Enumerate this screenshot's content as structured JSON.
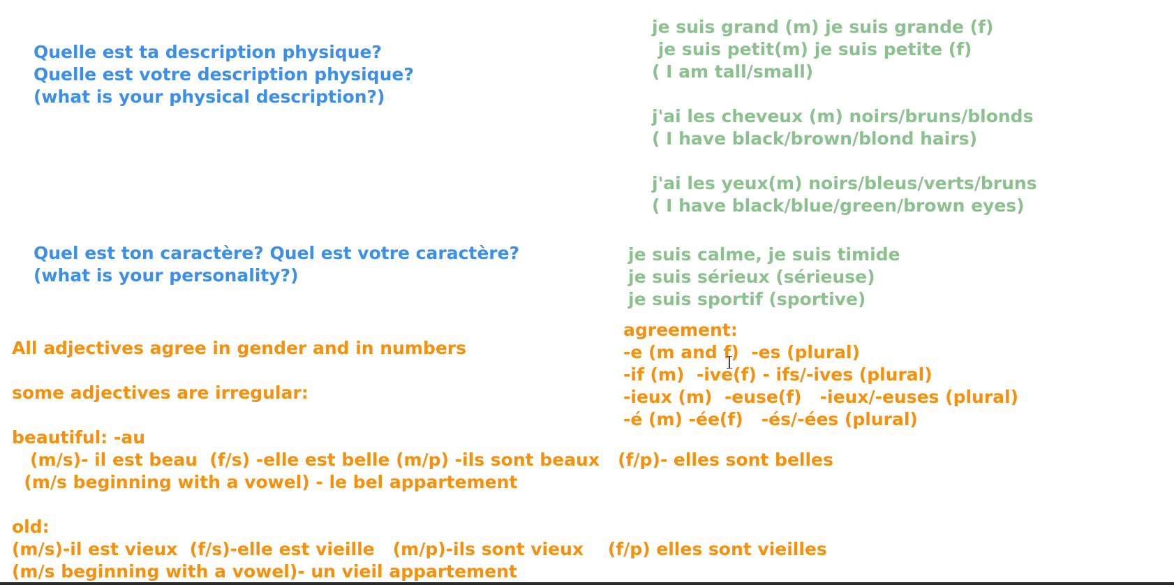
{
  "questions": {
    "physical": [
      "Quelle est ta description physique?",
      "Quelle est votre description physique?",
      "(what is your physical description?)"
    ],
    "personality": [
      "Quel est ton caractère? Quel est votre caractère?",
      "(what is your personality?)"
    ]
  },
  "answers": {
    "height": [
      "je suis grand (m) je suis grande (f)",
      " je suis petit(m) je suis petite (f)",
      "( I am tall/small)"
    ],
    "hair": [
      "j'ai les cheveux (m) noirs/bruns/blonds",
      "( I have black/brown/blond hairs)"
    ],
    "eyes": [
      "j'ai les yeux(m) noirs/bleus/verts/bruns",
      "( I have black/blue/green/brown eyes)"
    ],
    "personality": [
      "je suis calme, je suis timide",
      "je suis sérieux (sérieuse)",
      "je suis sportif (sportive)"
    ]
  },
  "agreement": {
    "heading": "agreement:",
    "rules": [
      "-e (m and f)  -es (plural)",
      "-if (m)  -ive(f) - ifs/-ives (plural)",
      "-ieux (m)  -euse(f)   -ieux/-euses (plural)",
      "-é (m) -ée(f)   -és/-ées (plural)"
    ]
  },
  "rules": {
    "general": "All adjectives agree in gender and in numbers",
    "irregular": "some adjectives are irregular:",
    "beautiful": {
      "heading": "beautiful: -au",
      "forms": "   (m/s)- il est beau  (f/s) -elle est belle (m/p) -ils sont beaux   (f/p)- elles sont belles",
      "vowel": "  (m/s beginning with a vowel) - le bel appartement"
    },
    "old": {
      "heading": "old:",
      "forms": "(m/s)-il est vieux  (f/s)-elle est vieille   (m/p)-ils sont vieux    (f/p) elles sont vieilles",
      "vowel": "(m/s beginning with a vowel)- un vieil appartement"
    }
  },
  "colors": {
    "question": "#3c8ee8",
    "answer": "#8cc08e",
    "grammar": "#f5900e"
  }
}
